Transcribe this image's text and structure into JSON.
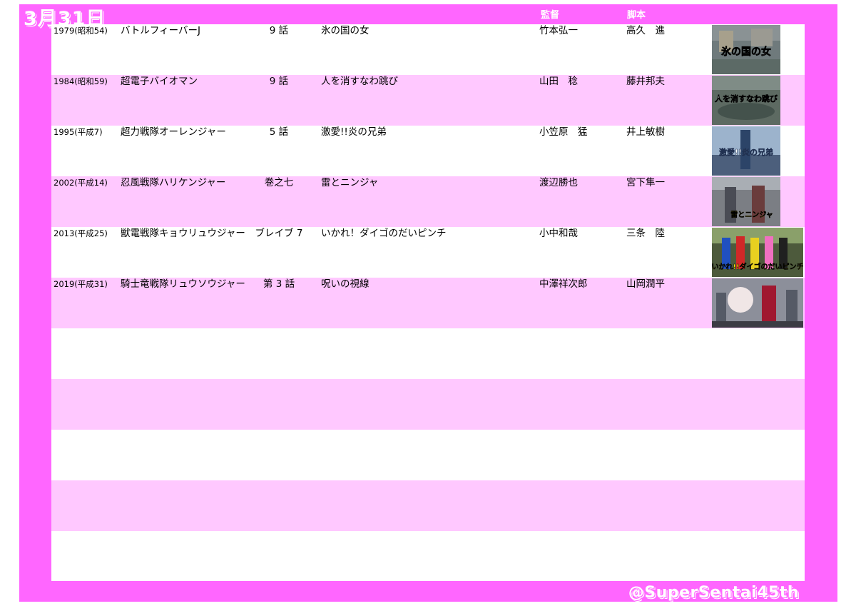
{
  "header": {
    "date": "3月31日",
    "director_label": "監督",
    "writer_label": "脚本"
  },
  "rows": [
    {
      "year": "1979(昭和54)",
      "series": "バトルフィーバーJ",
      "episode": "9 話",
      "title": "氷の国の女",
      "director": "竹本弘一",
      "writer": "高久　進",
      "thumb_caption": "氷の国の女"
    },
    {
      "year": "1984(昭和59)",
      "series": "超電子バイオマン",
      "episode": "9 話",
      "title": "人を消すなわ跳び",
      "director": "山田　稔",
      "writer": "藤井邦夫",
      "thumb_caption": "人を消すなわ跳び"
    },
    {
      "year": "1995(平成7)",
      "series": "超力戦隊オーレンジャー",
      "episode": "5 話",
      "title": "激愛!!炎の兄弟",
      "director": "小笠原　猛",
      "writer": "井上敏樹",
      "thumb_caption": "激愛!!炎の兄弟"
    },
    {
      "year": "2002(平成14)",
      "series": "忍風戦隊ハリケンジャー",
      "episode": "巻之七",
      "title": "雷とニンジャ",
      "director": "渡辺勝也",
      "writer": "宮下隼一",
      "thumb_caption": "雷とニンジャ"
    },
    {
      "year": "2013(平成25)",
      "series": "獣電戦隊キョウリュウジャー",
      "episode": "ブレイブ 7",
      "title": "いかれ！ダイゴのだいピンチ",
      "director": "小中和哉",
      "writer": "三条　陸",
      "thumb_caption": "いかれ!!ダイゴのだいピンチ"
    },
    {
      "year": "2019(平成31)",
      "series": "騎士竜戦隊リュウソウジャー",
      "episode": "第 3 話",
      "title": "呪いの視線",
      "director": "中澤祥次郎",
      "writer": "山岡潤平",
      "thumb_caption": ""
    }
  ],
  "footer": {
    "handle": "@SuperSentai45th"
  },
  "colors": {
    "frame": "#ff66ff",
    "row_pink": "#ffc8ff",
    "row_white": "#ffffff"
  }
}
